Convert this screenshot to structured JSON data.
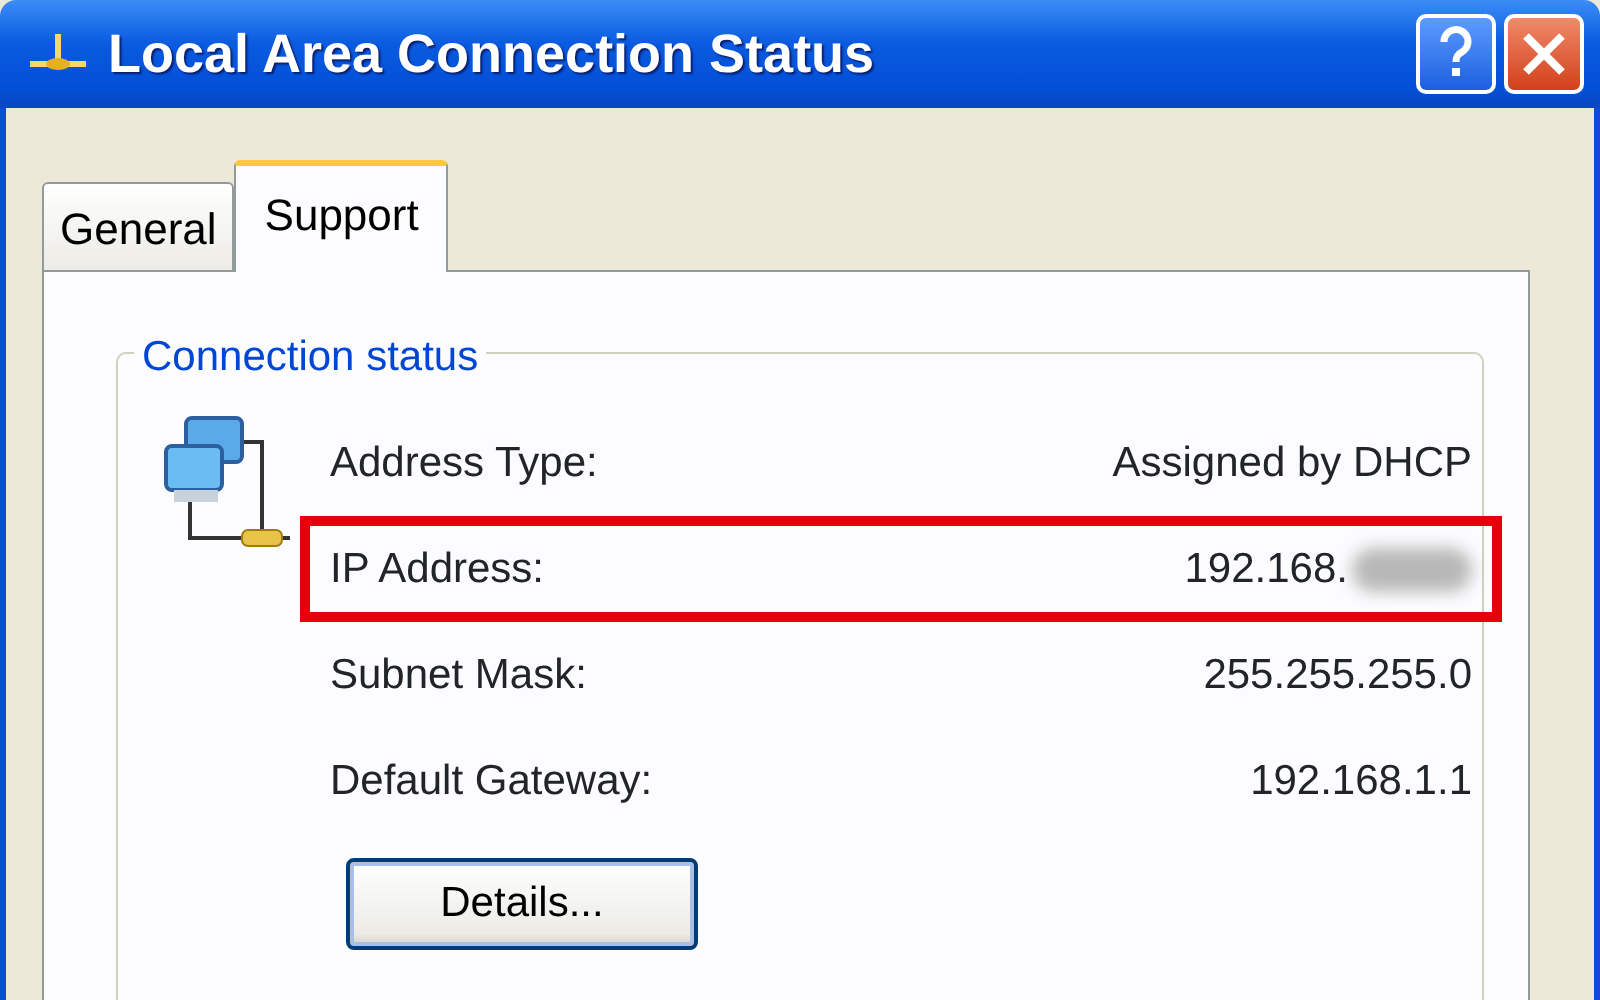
{
  "window": {
    "title": "Local Area Connection Status"
  },
  "tabs": [
    {
      "label": "General",
      "selected": false
    },
    {
      "label": "Support",
      "selected": true
    }
  ],
  "group": {
    "title": "Connection status"
  },
  "rows": [
    {
      "label": "Address Type:",
      "value": "Assigned by DHCP",
      "highlighted": false,
      "redacted": false
    },
    {
      "label": "IP Address:",
      "value": "192.168.",
      "highlighted": true,
      "redacted": true
    },
    {
      "label": "Subnet Mask:",
      "value": "255.255.255.0",
      "highlighted": false,
      "redacted": false
    },
    {
      "label": "Default Gateway:",
      "value": "192.168.1.1",
      "highlighted": false,
      "redacted": false
    }
  ],
  "buttons": [
    "Details..."
  ]
}
